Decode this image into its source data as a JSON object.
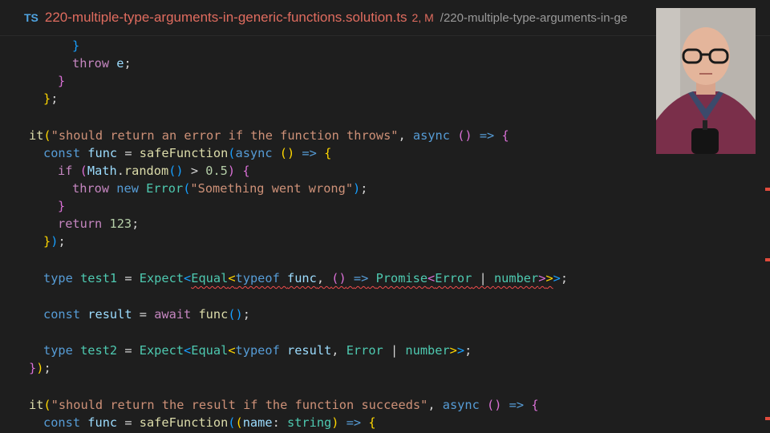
{
  "tab": {
    "lang_badge": "TS",
    "file_name": "220-multiple-type-arguments-in-generic-functions.solution.ts",
    "status": "2, M",
    "path": "/220-multiple-type-arguments-in-ge"
  },
  "code": {
    "lines": [
      "}",
      "throw e;",
      "}",
      "};",
      "",
      "it(\"should return an error if the function throws\", async () => {",
      "const func = safeFunction(async () => {",
      "if (Math.random() > 0.5) {",
      "throw new Error(\"Something went wrong\");",
      "}",
      "return 123;",
      "});",
      "",
      "type test1 = Expect<Equal<typeof func, () => Promise<Error | number>>>;",
      "",
      "const result = await func();",
      "",
      "type test2 = Expect<Equal<typeof result, Error | number>>;",
      "});",
      "",
      "it(\"should return the result if the function succeeds\", async () => {",
      "const func = safeFunction((name: string) => {"
    ]
  },
  "tokens": {
    "it": "it",
    "str_throws": "\"should return an error if the function throws\"",
    "str_succeeds": "\"should return the result if the function succeeds\"",
    "async": "async",
    "const": "const",
    "func": "func",
    "safeFunction": "safeFunction",
    "if": "if",
    "Math": "Math",
    "random": "random",
    "num_half": "0.5",
    "throw": "throw",
    "new": "new",
    "Error": "Error",
    "str_wrong": "\"Something went wrong\"",
    "return": "return",
    "num_123": "123",
    "type": "type",
    "test1": "test1",
    "test2": "test2",
    "Expect": "Expect",
    "Equal": "Equal",
    "typeof": "typeof",
    "Promise": "Promise",
    "number": "number",
    "result": "result",
    "await": "await",
    "e": "e",
    "name": "name",
    "string": "string",
    "arrow": "=>"
  },
  "colors": {
    "keyword": "#569cd6",
    "control": "#c586c0",
    "function": "#dcdcaa",
    "string": "#ce9178",
    "number": "#b5cea8",
    "type": "#4ec9b0",
    "variable": "#9cdcfe",
    "error_squiggle": "#f14c4c",
    "tab_modified": "#e06c5f"
  },
  "webcam": {
    "description_icon": "presenter-webcam"
  }
}
